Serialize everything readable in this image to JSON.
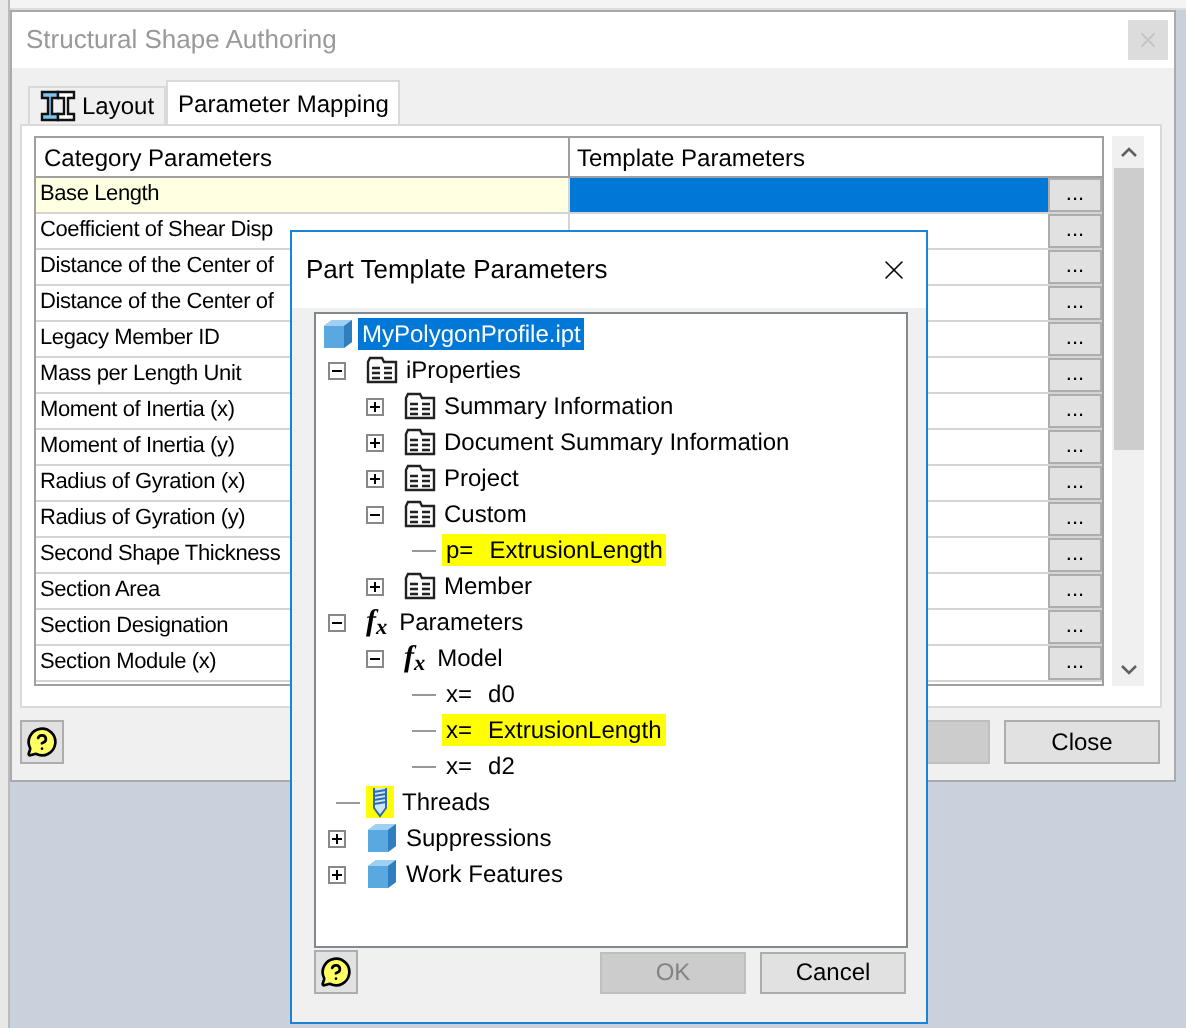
{
  "main_window": {
    "title": "Structural Shape Authoring",
    "tabs": [
      {
        "label": "Layout",
        "selected": false
      },
      {
        "label": "Parameter Mapping",
        "selected": true
      }
    ],
    "table": {
      "columns": [
        "Category Parameters",
        "Template Parameters"
      ],
      "rows": [
        {
          "category": "Base Length",
          "selected": true,
          "button": "..."
        },
        {
          "category": "Coefficient of Shear Disp",
          "selected": false,
          "button": "..."
        },
        {
          "category": "Distance of the Center of",
          "selected": false,
          "button": "..."
        },
        {
          "category": "Distance of the Center of",
          "selected": false,
          "button": "..."
        },
        {
          "category": "Legacy Member ID",
          "selected": false,
          "button": "..."
        },
        {
          "category": "Mass per Length Unit",
          "selected": false,
          "button": "..."
        },
        {
          "category": "Moment of Inertia (x)",
          "selected": false,
          "button": "..."
        },
        {
          "category": "Moment of Inertia (y)",
          "selected": false,
          "button": "..."
        },
        {
          "category": "Radius of Gyration (x)",
          "selected": false,
          "button": "..."
        },
        {
          "category": "Radius of Gyration (y)",
          "selected": false,
          "button": "..."
        },
        {
          "category": "Second Shape Thickness",
          "selected": false,
          "button": "..."
        },
        {
          "category": "Section Area",
          "selected": false,
          "button": "..."
        },
        {
          "category": "Section Designation",
          "selected": false,
          "button": "..."
        },
        {
          "category": "Section Module (x)",
          "selected": false,
          "button": "..."
        }
      ]
    },
    "close_button": "Close"
  },
  "dialog": {
    "title": "Part Template Parameters",
    "tree": [
      {
        "label": "MyPolygonProfile.ipt",
        "kind": "part",
        "selected": true,
        "children": [
          {
            "label": "iProperties",
            "kind": "properties",
            "expanded": true,
            "children": [
              {
                "label": "Summary Information",
                "kind": "properties",
                "expanded": false
              },
              {
                "label": "Document Summary Information",
                "kind": "properties",
                "expanded": false
              },
              {
                "label": "Project",
                "kind": "properties",
                "expanded": false
              },
              {
                "label": "Custom",
                "kind": "properties",
                "expanded": true,
                "children": [
                  {
                    "label": "ExtrusionLength",
                    "kind": "parameter",
                    "icon_text": "p=",
                    "highlighted": true
                  }
                ]
              },
              {
                "label": "Member",
                "kind": "properties",
                "expanded": false
              }
            ]
          },
          {
            "label": "Parameters",
            "kind": "parameter_group",
            "icon_text": "f$_{x}$",
            "expanded": true,
            "children": [
              {
                "label": "Model",
                "kind": "parameter_group",
                "icon_text": "f$_{x}$",
                "expanded": true,
                "children": [
                  {
                    "label": "d0",
                    "kind": "parameter",
                    "icon_text": "x=",
                    "highlighted": false
                  },
                  {
                    "label": "ExtrusionLength",
                    "kind": "parameter",
                    "icon_text": "x=",
                    "highlighted": true
                  },
                  {
                    "label": "d2",
                    "kind": "parameter",
                    "icon_text": "x=",
                    "highlighted": false
                  }
                ]
              }
            ]
          },
          {
            "label": "Threads",
            "kind": "threads"
          },
          {
            "label": "Suppressions",
            "kind": "feature",
            "expanded": false
          },
          {
            "label": "Work Features",
            "kind": "feature",
            "expanded": false
          }
        ]
      }
    ],
    "ok_button": {
      "label": "OK",
      "disabled": true
    },
    "cancel_button": "Cancel"
  }
}
